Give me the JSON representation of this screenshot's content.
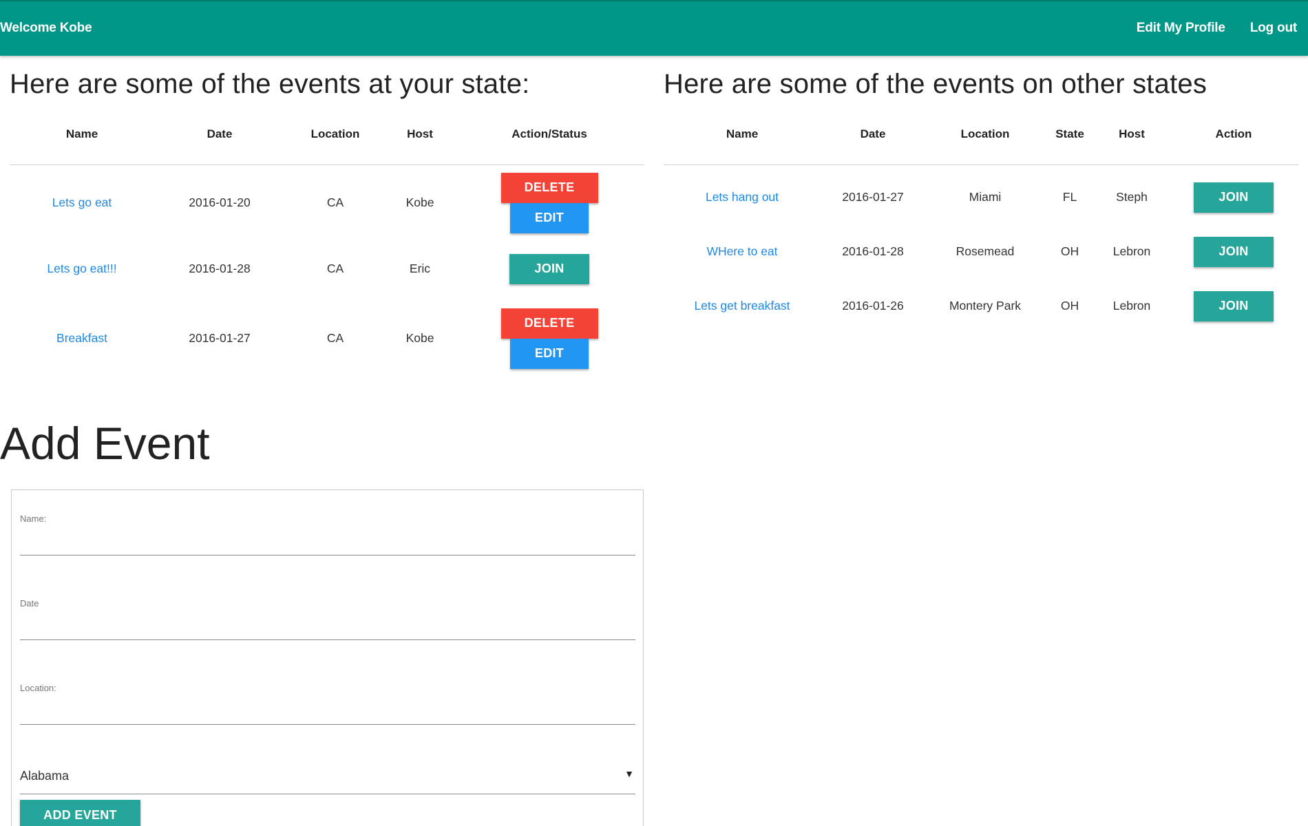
{
  "nav": {
    "brand": "Welcome Kobe",
    "edit_profile": "Edit My Profile",
    "logout": "Log out"
  },
  "colors": {
    "navbar": "#009688",
    "delete": "#f44336",
    "edit": "#2196f3",
    "join": "#26a69a",
    "link": "#1e88e5"
  },
  "state_events": {
    "title": "Here are some of the events at your state:",
    "headers": [
      "Name",
      "Date",
      "Location",
      "Host",
      "Action/Status"
    ],
    "rows": [
      {
        "name": "Lets go eat",
        "date": "2016-01-20",
        "location": "CA",
        "host": "Kobe",
        "delete": "DELETE",
        "edit": "EDIT"
      },
      {
        "name": "Lets go eat!!!",
        "date": "2016-01-28",
        "location": "CA",
        "host": "Eric",
        "join": "JOIN"
      },
      {
        "name": "Breakfast",
        "date": "2016-01-27",
        "location": "CA",
        "host": "Kobe",
        "delete": "DELETE",
        "edit": "EDIT"
      }
    ]
  },
  "other_events": {
    "title": "Here are some of the events on other states",
    "headers": [
      "Name",
      "Date",
      "Location",
      "State",
      "Host",
      "Action"
    ],
    "rows": [
      {
        "name": "Lets hang out",
        "date": "2016-01-27",
        "location": "Miami",
        "state": "FL",
        "host": "Steph",
        "join": "JOIN"
      },
      {
        "name": "WHere to eat",
        "date": "2016-01-28",
        "location": "Rosemead",
        "state": "OH",
        "host": "Lebron",
        "join": "JOIN"
      },
      {
        "name": "Lets get breakfast",
        "date": "2016-01-26",
        "location": "Montery Park",
        "state": "OH",
        "host": "Lebron",
        "join": "JOIN"
      }
    ]
  },
  "add_event": {
    "title": "Add Event",
    "name_label": "Name:",
    "name_value": "",
    "date_label": "Date",
    "date_value": "",
    "location_label": "Location:",
    "location_value": "",
    "state_selected": "Alabama",
    "submit": "ADD EVENT"
  }
}
